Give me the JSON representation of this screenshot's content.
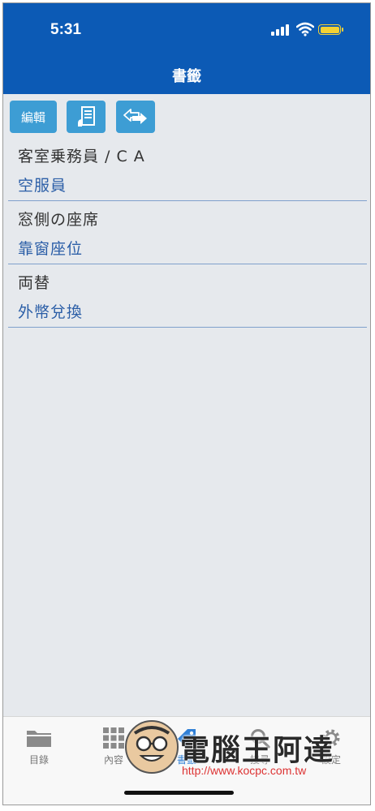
{
  "status_bar": {
    "time": "5:31"
  },
  "header": {
    "title": "書籤"
  },
  "toolbar": {
    "edit_label": "編輯"
  },
  "bookmarks": [
    {
      "japanese": "客室乗務員 / C A",
      "chinese": "空服員"
    },
    {
      "japanese": "窓側の座席",
      "chinese": "靠窗座位"
    },
    {
      "japanese": "両替",
      "chinese": "外幣兌換"
    }
  ],
  "tabs": [
    {
      "label": "目錄"
    },
    {
      "label": "內容"
    },
    {
      "label": "書籤"
    },
    {
      "label": "搜尋"
    },
    {
      "label": "設定"
    }
  ],
  "watermark": {
    "title": "電腦王阿達",
    "url": "http://www.kocpc.com.tw"
  },
  "colors": {
    "header_bg": "#0c5ab5",
    "button_bg": "#3d9dd4",
    "chinese_text": "#2b5ea7",
    "list_bg": "#e6e9ed"
  }
}
